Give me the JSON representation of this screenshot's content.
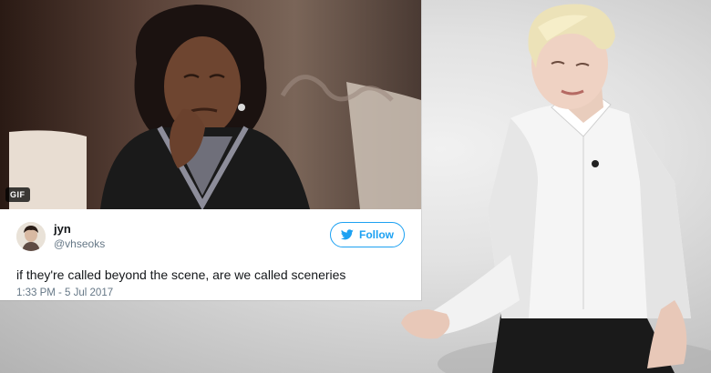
{
  "tweet": {
    "media_badge": "GIF",
    "display_name": "jyn",
    "handle": "@vhseoks",
    "follow_label": "Follow",
    "text": "if they're called beyond the scene, are we called sceneries",
    "timestamp": "1:33 PM - 5 Jul 2017"
  },
  "icons": {
    "follow": "twitter-bird-icon"
  },
  "colors": {
    "twitter_blue": "#1da1f2",
    "text_primary": "#14171a",
    "text_secondary": "#657786"
  }
}
